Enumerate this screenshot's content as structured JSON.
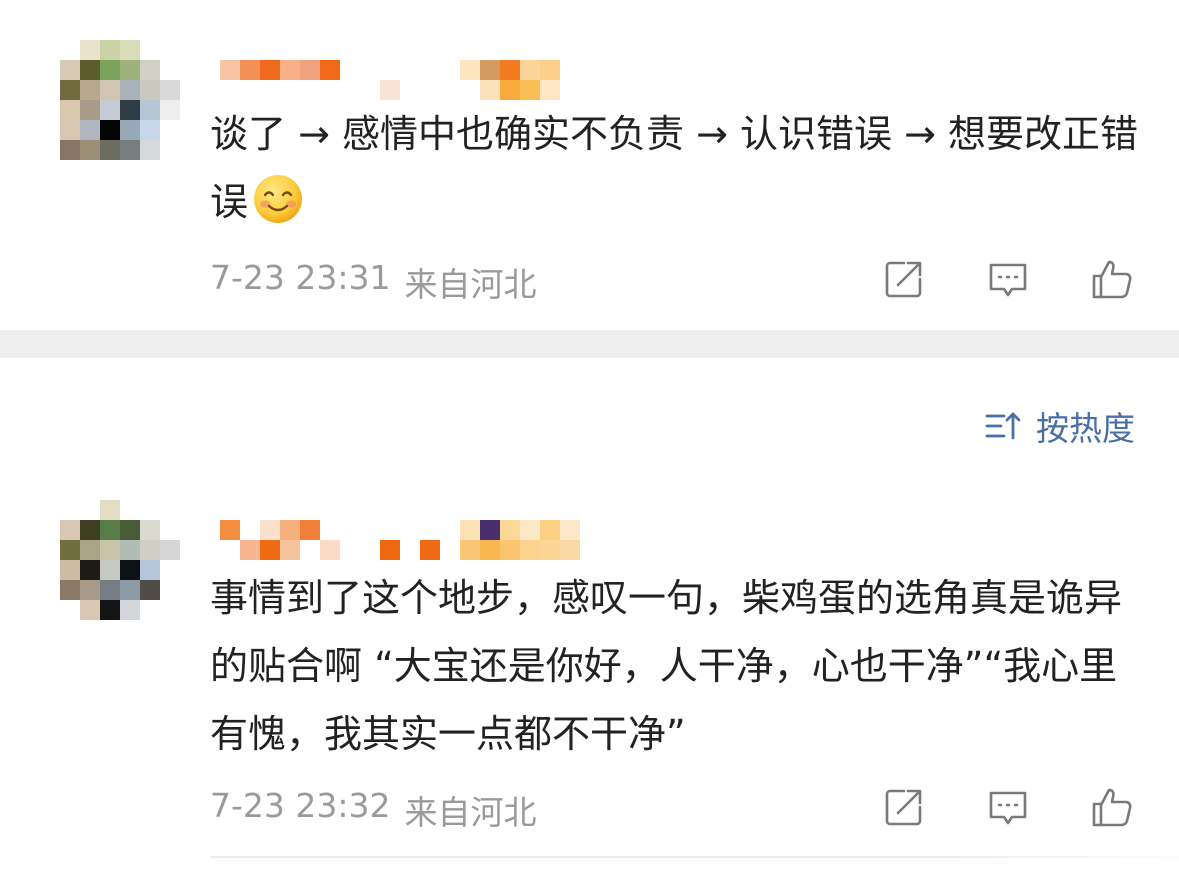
{
  "comments": [
    {
      "text": "谈了 → 感情中也确实不负责 → 认识错误 → 想要改正错误",
      "emoji": "smiling-face-emoji",
      "date": "7-23 23:31",
      "location": "来自河北"
    },
    {
      "text": "事情到了这个地步，感叹一句，柴鸡蛋的选角真是诡异的贴合啊 “大宝还是你好，人干净，心也干净”“我心里有愧，我其实一点都不干净”",
      "date": "7-23 23:32",
      "location": "来自河北"
    }
  ],
  "sort": {
    "label": "按热度",
    "icon": "sort-icon"
  },
  "actions": [
    "share-icon",
    "comment-icon",
    "like-icon"
  ],
  "colors": {
    "accent": "#4a6fa5",
    "meta_text": "#9a9a9a",
    "divider": "#eeeeee",
    "icon_stroke": "#7a7a7a"
  }
}
